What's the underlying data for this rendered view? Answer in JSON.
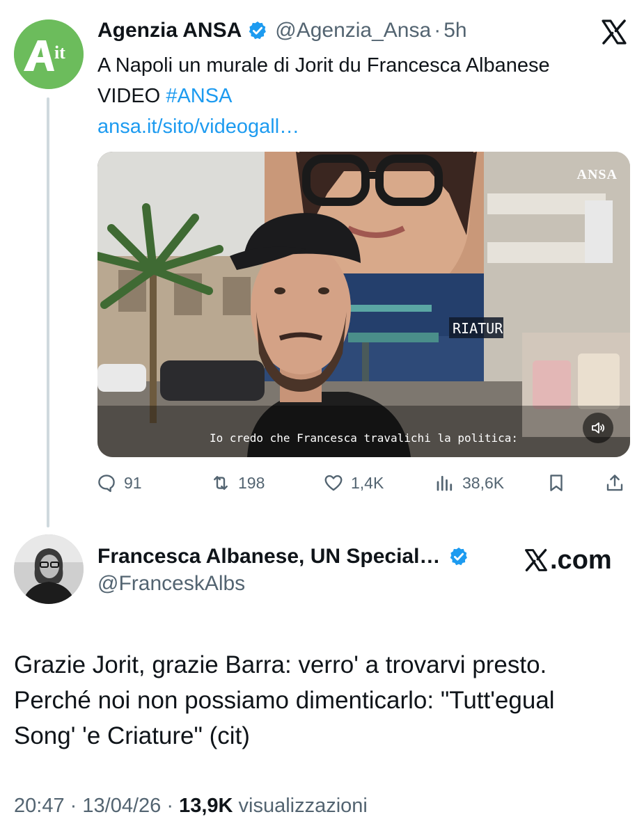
{
  "quoted_tweet": {
    "author_name": "Agenzia ANSA",
    "avatar_text": "it",
    "handle": "@Agenzia_Ansa",
    "separator": "·",
    "time_ago": "5h",
    "text": "A Napoli un murale di Jorit du Francesca Albanese VIDEO",
    "hashtag": "#ANSA",
    "link": "ansa.it/sito/videogall…",
    "video": {
      "watermark": "ANSA",
      "subtitle": "Io credo che Francesca travalichi la politica:",
      "mural_sign": "RIATUR",
      "mute_icon": "speaker-muted-icon"
    },
    "stats": {
      "replies": "91",
      "reposts": "198",
      "likes": "1,4K",
      "views": "38,6K"
    }
  },
  "main_tweet": {
    "author_name": "Francesca Albanese, UN Special…",
    "handle": "@FranceskAlbs",
    "source_label": ".com",
    "text_line1": "Grazie Jorit, grazie Barra: verro' a trovarvi presto.",
    "text_line2": "Perché noi non possiamo dimenticarlo: \"Tutt'egual",
    "text_line3": "Song' 'e Criature\" (cit)",
    "time": "20:47",
    "separator": "·",
    "date": "13/04/26",
    "views_count": "13,9K",
    "views_label": "visualizzazioni"
  },
  "colors": {
    "accent": "#1d9bf0",
    "muted_text": "#536471",
    "primary_text": "#0f1419",
    "thread_line": "#cfd9de",
    "ansa_green": "#6cbc5c"
  }
}
